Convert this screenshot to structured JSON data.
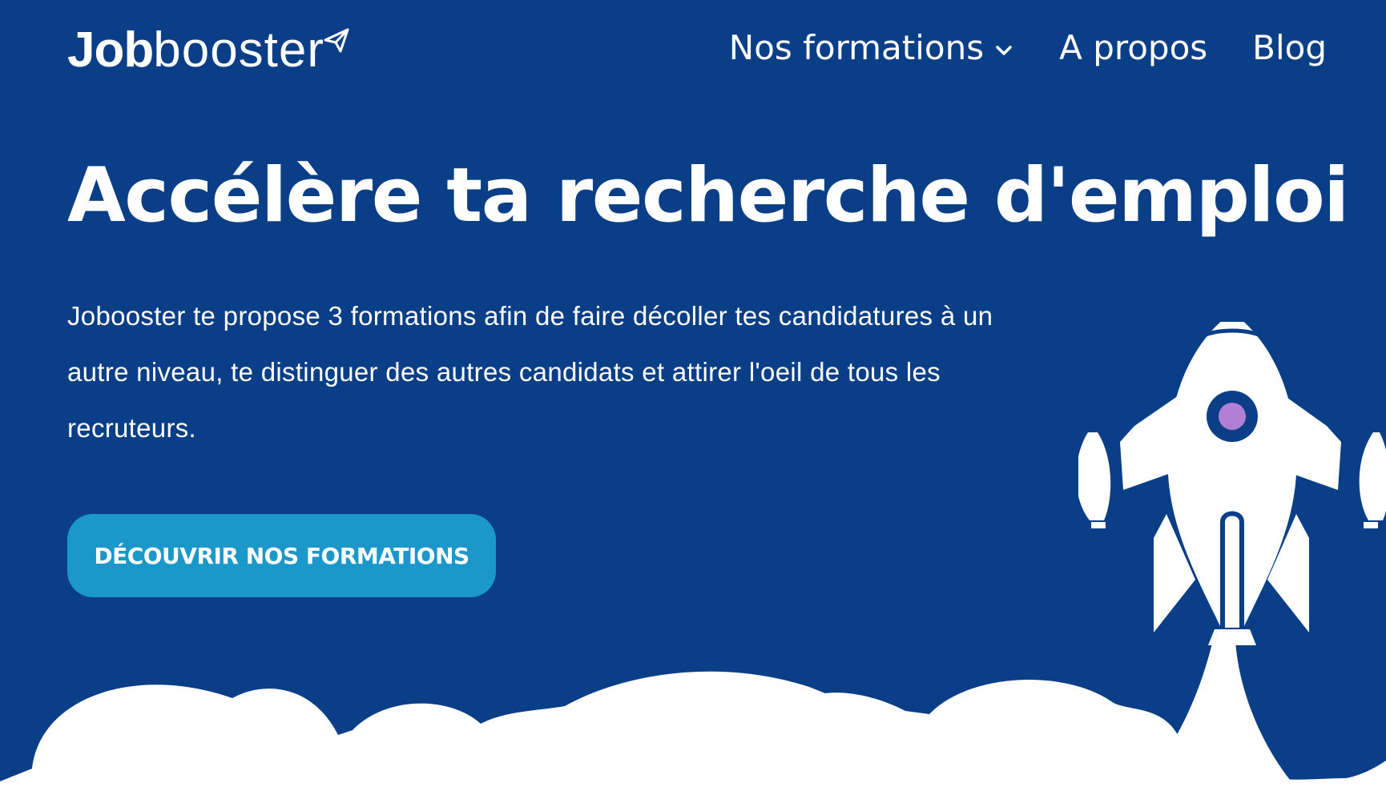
{
  "colors": {
    "background": "#0a3f87",
    "accent_button": "#1b98c9",
    "text": "#ffffff",
    "rocket_window": "#b17fd6"
  },
  "header": {
    "logo": {
      "part_bold": "Job",
      "part_light": "booster",
      "icon": "paper-plane-icon"
    },
    "nav": {
      "formations_label": "Nos formations",
      "formations_icon": "chevron-down-icon",
      "about_label": "A propos",
      "blog_label": "Blog"
    }
  },
  "hero": {
    "title": "Accélère ta recherche d'emploi",
    "description": "Jobooster te propose 3 formations afin de faire décoller tes candidatures à un autre niveau, te distinguer des autres candidats et attirer l'oeil de tous les recruteurs.",
    "cta_label": "DÉCOUVRIR NOS FORMATIONS"
  },
  "illustration": {
    "rocket_icon": "rocket-icon",
    "clouds_icon": "clouds-illustration"
  }
}
